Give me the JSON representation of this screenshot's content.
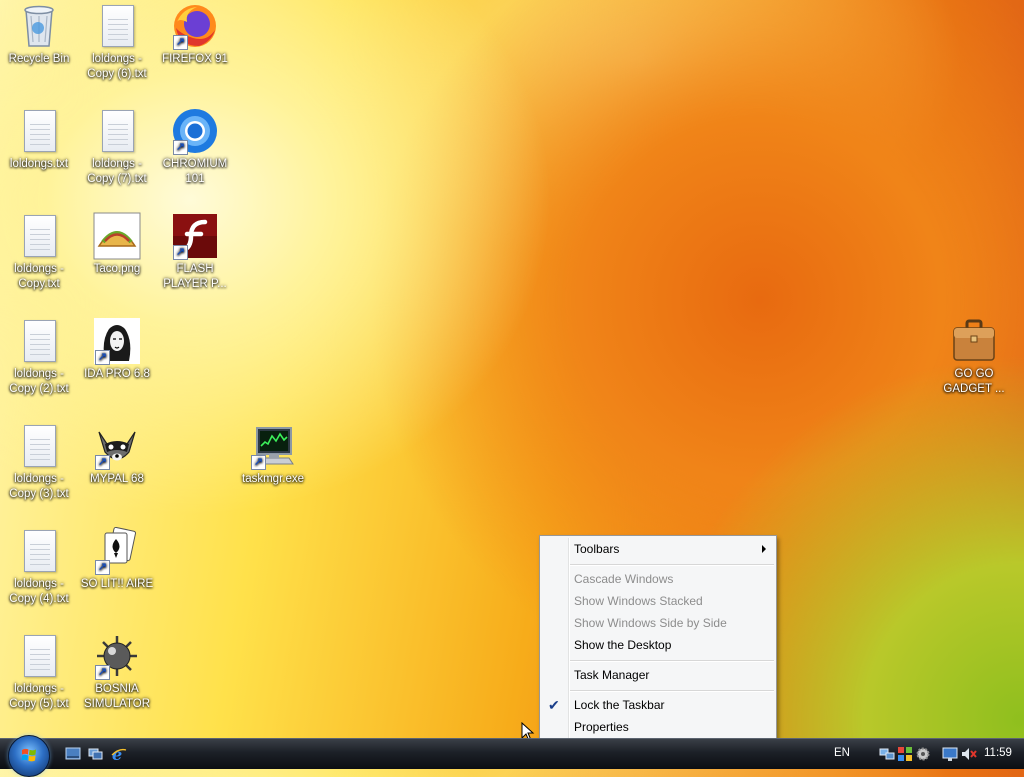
{
  "desktop_icons": [
    {
      "id": "recycle-bin",
      "label": "Recycle Bin",
      "icon": "recycle-bin-icon",
      "shortcut": false
    },
    {
      "id": "loldongs-copy-6",
      "label": "loldongs - Copy (6).txt",
      "icon": "text-file-icon",
      "shortcut": false
    },
    {
      "id": "firefox",
      "label": "FIREFOX 91",
      "icon": "firefox-icon",
      "shortcut": true
    },
    {
      "id": "loldongs",
      "label": "loldongs.txt",
      "icon": "text-file-icon",
      "shortcut": false
    },
    {
      "id": "loldongs-copy-7",
      "label": "loldongs - Copy (7).txt",
      "icon": "text-file-icon",
      "shortcut": false
    },
    {
      "id": "chromium",
      "label": "CHROMIUM 101",
      "icon": "chromium-icon",
      "shortcut": true
    },
    {
      "id": "loldongs-copy",
      "label": "loldongs - Copy.txt",
      "icon": "text-file-icon",
      "shortcut": false
    },
    {
      "id": "taco",
      "label": "Taco.png",
      "icon": "taco-image-icon",
      "shortcut": false
    },
    {
      "id": "flash",
      "label": "FLASH PLAYER P...",
      "icon": "flash-player-icon",
      "shortcut": true
    },
    {
      "id": "loldongs-copy-2",
      "label": "loldongs - Copy (2).txt",
      "icon": "text-file-icon",
      "shortcut": false
    },
    {
      "id": "ida",
      "label": "IDA PRO 6.8",
      "icon": "ida-pro-icon",
      "shortcut": true
    },
    {
      "id": "loldongs-copy-3",
      "label": "loldongs - Copy (3).txt",
      "icon": "text-file-icon",
      "shortcut": false
    },
    {
      "id": "mypal",
      "label": "MYPAL 68",
      "icon": "mypal-raccoon-icon",
      "shortcut": true
    },
    {
      "id": "taskmgr",
      "label": "taskmgr.exe",
      "icon": "task-manager-icon",
      "shortcut": true
    },
    {
      "id": "loldongs-copy-4",
      "label": "loldongs - Copy (4).txt",
      "icon": "text-file-icon",
      "shortcut": false
    },
    {
      "id": "solitaire",
      "label": "SO LIT!! AIRE",
      "icon": "solitaire-cards-icon",
      "shortcut": true
    },
    {
      "id": "loldongs-copy-5",
      "label": "loldongs - Copy (5).txt",
      "icon": "text-file-icon",
      "shortcut": false
    },
    {
      "id": "bosnia",
      "label": "BOSNIA SIMULATOR",
      "icon": "minesweeper-mine-icon",
      "shortcut": true
    },
    {
      "id": "gadget",
      "label": "GO GO GADGET ...",
      "icon": "briefcase-icon",
      "shortcut": false
    }
  ],
  "context_menu": {
    "items": [
      {
        "label": "Toolbars",
        "enabled": true,
        "submenu": true
      },
      {
        "label": "Cascade Windows",
        "enabled": false
      },
      {
        "label": "Show Windows Stacked",
        "enabled": false
      },
      {
        "label": "Show Windows Side by Side",
        "enabled": false
      },
      {
        "label": "Show the Desktop",
        "enabled": true
      },
      {
        "label": "Task Manager",
        "enabled": true
      },
      {
        "label": "Lock the Taskbar",
        "enabled": true,
        "checked": true
      },
      {
        "label": "Properties",
        "enabled": true
      }
    ]
  },
  "taskbar": {
    "quick_launch": [
      "show-desktop-icon",
      "switch-windows-icon",
      "internet-explorer-icon"
    ],
    "language": "EN",
    "clock": "11:59",
    "tray_icons": [
      "network-icon",
      "windows-update-icon",
      "settings-gear-icon",
      "display-icon",
      "volume-muted-icon"
    ]
  },
  "colors": {
    "accent": "#1a4fb8",
    "menu_bg": "#f5f6f7",
    "disabled_text": "#8d8d8d"
  }
}
